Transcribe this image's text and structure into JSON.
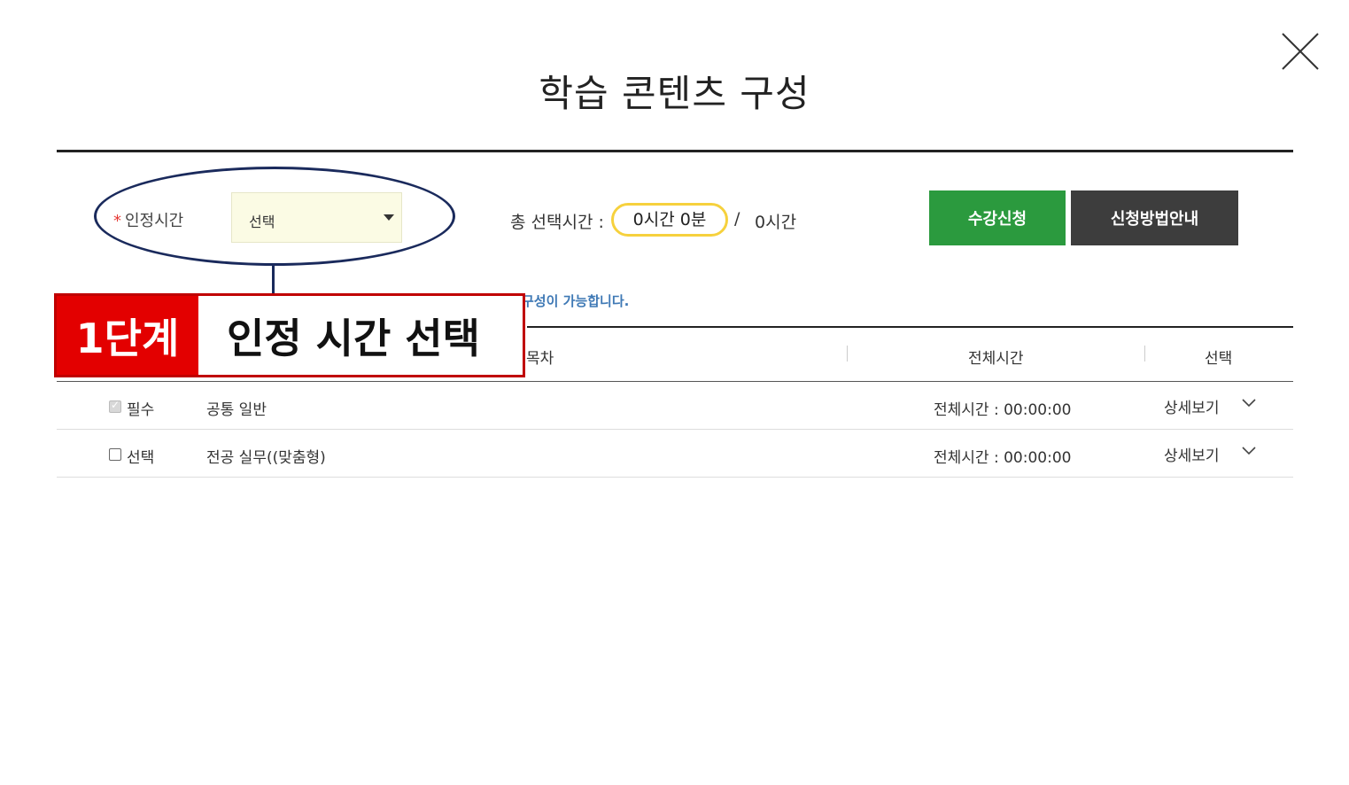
{
  "header": {
    "title": "학습 콘텐츠 구성"
  },
  "filter": {
    "required_mark": "*",
    "cert_time_label": "인정시간",
    "select_value": "선택"
  },
  "summary": {
    "total_label": "총 선택시간 :",
    "selected_time": "0시간 0분",
    "separator": "/",
    "max_time": "0시간"
  },
  "buttons": {
    "apply": "수강신청",
    "guide": "신청방법안내"
  },
  "notice": "구성이 가능합니다.",
  "callout": {
    "step": "1단계",
    "text": "인정 시간 선택"
  },
  "table": {
    "headers": [
      "목차",
      "전체시간",
      "선택"
    ],
    "rows": [
      {
        "type": "필수",
        "name": "공통 일반",
        "time": "전체시간 : 00:00:00",
        "detail": "상세보기",
        "checked": true
      },
      {
        "type": "선택",
        "name": "전공 실무((맞춤형)",
        "time": "전체시간 : 00:00:00",
        "detail": "상세보기",
        "checked": false
      }
    ]
  },
  "colors": {
    "apply_button": "#2b9a3e",
    "guide_button": "#3d3d3d",
    "step_red": "#e30000",
    "ellipse_navy": "#1a2a5c",
    "pill_yellow": "#f6d13d",
    "notice_blue": "#3f79b5"
  },
  "icons": {
    "close": "close-icon",
    "dropdown": "caret-down-icon",
    "expand": "chevron-down-icon"
  }
}
